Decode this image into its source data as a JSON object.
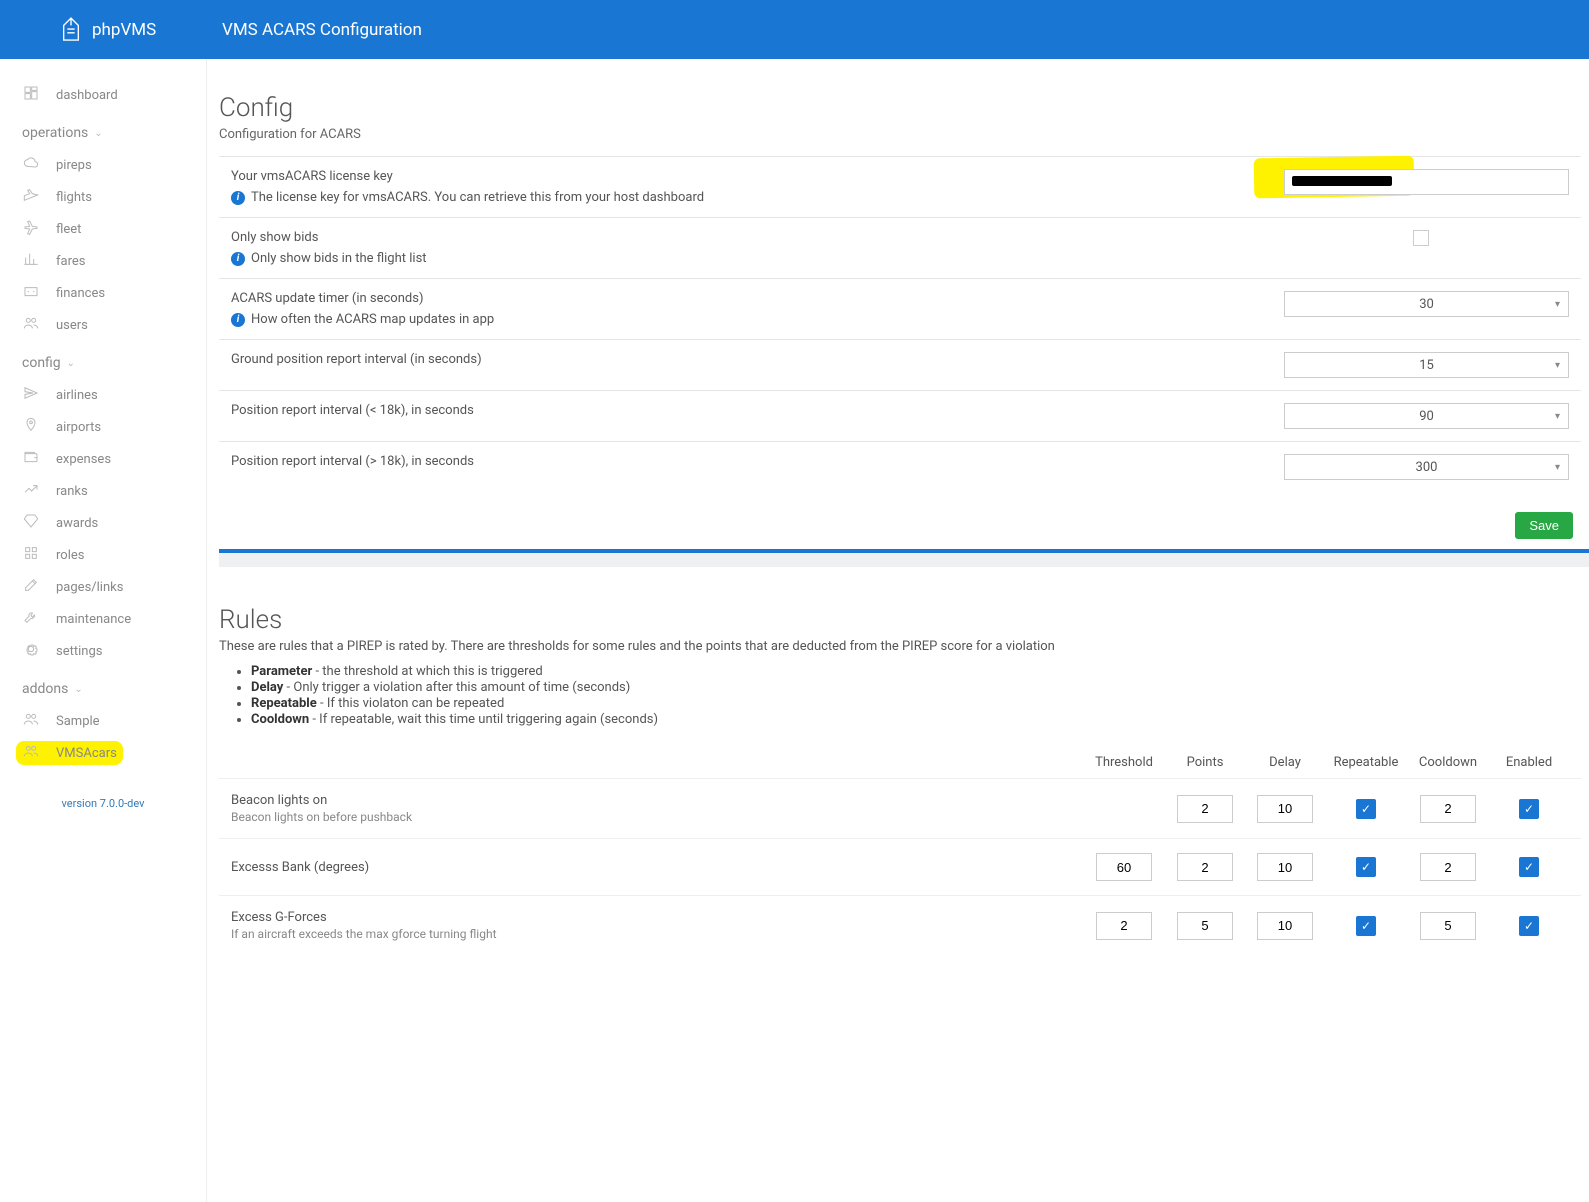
{
  "header": {
    "brand": "phpVMS",
    "title": "VMS ACARS Configuration"
  },
  "sidebar": {
    "top_items": [
      {
        "label": "dashboard",
        "icon": "dashboard"
      }
    ],
    "groups": [
      {
        "label": "operations",
        "items": [
          {
            "label": "pireps",
            "icon": "cloud"
          },
          {
            "label": "flights",
            "icon": "takeoff"
          },
          {
            "label": "fleet",
            "icon": "plane"
          },
          {
            "label": "fares",
            "icon": "chart"
          },
          {
            "label": "finances",
            "icon": "money"
          },
          {
            "label": "users",
            "icon": "users"
          }
        ]
      },
      {
        "label": "config",
        "items": [
          {
            "label": "airlines",
            "icon": "send"
          },
          {
            "label": "airports",
            "icon": "pin"
          },
          {
            "label": "expenses",
            "icon": "wallet"
          },
          {
            "label": "ranks",
            "icon": "trend"
          },
          {
            "label": "awards",
            "icon": "diamond"
          },
          {
            "label": "roles",
            "icon": "grid"
          },
          {
            "label": "pages/links",
            "icon": "edit"
          },
          {
            "label": "maintenance",
            "icon": "wrench"
          },
          {
            "label": "settings",
            "icon": "gear"
          }
        ]
      },
      {
        "label": "addons",
        "items": [
          {
            "label": "Sample",
            "icon": "users"
          },
          {
            "label": "VMSAcars",
            "icon": "users",
            "highlighted": true
          }
        ]
      }
    ],
    "version": "version 7.0.0-dev"
  },
  "config": {
    "title": "Config",
    "subtitle": "Configuration for ACARS",
    "rows": [
      {
        "label": "Your vmsACARS license key",
        "help": "The license key for vmsACARS. You can retrieve this from your host dashboard",
        "type": "text",
        "value": "",
        "highlighted": true
      },
      {
        "label": "Only show bids",
        "help": "Only show bids in the flight list",
        "type": "checkbox",
        "value": false
      },
      {
        "label": "ACARS update timer (in seconds)",
        "help": "How often the ACARS map updates in app",
        "type": "select",
        "value": "30"
      },
      {
        "label": "Ground position report interval (in seconds)",
        "type": "select",
        "value": "15"
      },
      {
        "label": "Position report interval (< 18k), in seconds",
        "type": "select",
        "value": "90"
      },
      {
        "label": "Position report interval (> 18k), in seconds",
        "type": "select",
        "value": "300"
      }
    ],
    "save_label": "Save"
  },
  "rules": {
    "title": "Rules",
    "desc": "These are rules that a PIREP is rated by. There are thresholds for some rules and the points that are deducted from the PIREP score for a violation",
    "bullets": [
      {
        "term": "Parameter",
        "text": " - the threshold at which this is triggered"
      },
      {
        "term": "Delay",
        "text": " - Only trigger a violation after this amount of time (seconds)"
      },
      {
        "term": "Repeatable",
        "text": " - If this violaton can be repeated"
      },
      {
        "term": "Cooldown",
        "text": " - If repeatable, wait this time until triggering again (seconds)"
      }
    ],
    "headers": [
      "Threshold",
      "Points",
      "Delay",
      "Repeatable",
      "Cooldown",
      "Enabled"
    ],
    "rows": [
      {
        "name": "Beacon lights on",
        "desc": "Beacon lights on before pushback",
        "threshold": "",
        "points": "2",
        "delay": "10",
        "repeatable": true,
        "cooldown": "2",
        "enabled": true
      },
      {
        "name": "Excesss Bank (degrees)",
        "desc": "",
        "threshold": "60",
        "points": "2",
        "delay": "10",
        "repeatable": true,
        "cooldown": "2",
        "enabled": true
      },
      {
        "name": "Excess G-Forces",
        "desc": "If an aircraft exceeds the max gforce turning flight",
        "threshold": "2",
        "points": "5",
        "delay": "10",
        "repeatable": true,
        "cooldown": "5",
        "enabled": true
      }
    ]
  }
}
